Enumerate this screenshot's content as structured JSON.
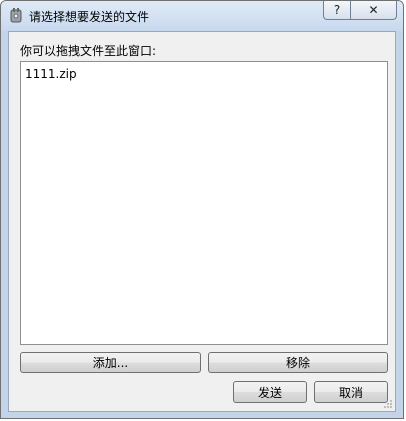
{
  "window": {
    "title": "请选择想要发送的文件",
    "help_label": "?",
    "close_label": "✕"
  },
  "dialog": {
    "drop_label": "你可以拖拽文件至此窗口:",
    "files": [
      "1111.zip"
    ]
  },
  "buttons": {
    "add": "添加...",
    "remove": "移除",
    "send": "发送",
    "cancel": "取消"
  }
}
